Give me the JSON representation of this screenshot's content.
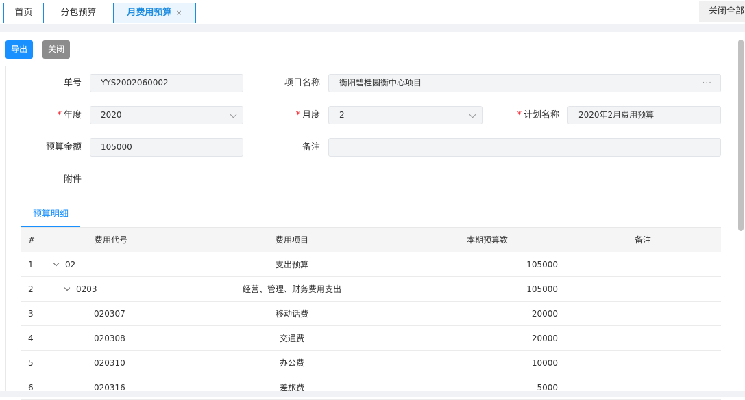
{
  "tabs": [
    {
      "label": "首页"
    },
    {
      "label": "分包预算"
    },
    {
      "label": "月费用预算",
      "close": "×"
    }
  ],
  "close_all": "关闭全部",
  "toolbar": {
    "export_label": "导出",
    "close_label": "关闭"
  },
  "form": {
    "order_no_label": "单号",
    "order_no": "YYS2002060002",
    "project_label": "项目名称",
    "project": "衡阳碧桂园衡中心项目",
    "project_more": "···",
    "required_mark": "*",
    "year_label": "年度",
    "year": "2020",
    "month_label": "月度",
    "month": "2",
    "plan_label": "计划名称",
    "plan": "2020年2月费用预算",
    "amount_label": "预算金额",
    "amount": "105000",
    "remark_label": "备注",
    "remark": "",
    "attachment_label": "附件"
  },
  "detail_tab": "预算明细",
  "table": {
    "headers": [
      "#",
      "费用代号",
      "费用项目",
      "本期预算数",
      "备注"
    ],
    "rows": [
      {
        "idx": "1",
        "code": "02",
        "item": "支出预算",
        "amount": "105000",
        "remark": "",
        "level": 0,
        "expandable": true
      },
      {
        "idx": "2",
        "code": "0203",
        "item": "经营、管理、财务费用支出",
        "amount": "105000",
        "remark": "",
        "level": 1,
        "expandable": true
      },
      {
        "idx": "3",
        "code": "020307",
        "item": "移动话费",
        "amount": "20000",
        "remark": "",
        "level": 2,
        "expandable": false
      },
      {
        "idx": "4",
        "code": "020308",
        "item": "交通费",
        "amount": "20000",
        "remark": "",
        "level": 2,
        "expandable": false
      },
      {
        "idx": "5",
        "code": "020310",
        "item": "办公费",
        "amount": "10000",
        "remark": "",
        "level": 2,
        "expandable": false
      },
      {
        "idx": "6",
        "code": "020316",
        "item": "差旅费",
        "amount": "5000",
        "remark": "",
        "level": 2,
        "expandable": false
      }
    ]
  },
  "colors": {
    "accent": "#1890ff",
    "tab_border": "#1d8ce0",
    "required": "#f5222d",
    "close_button": "#8c8c8c"
  }
}
